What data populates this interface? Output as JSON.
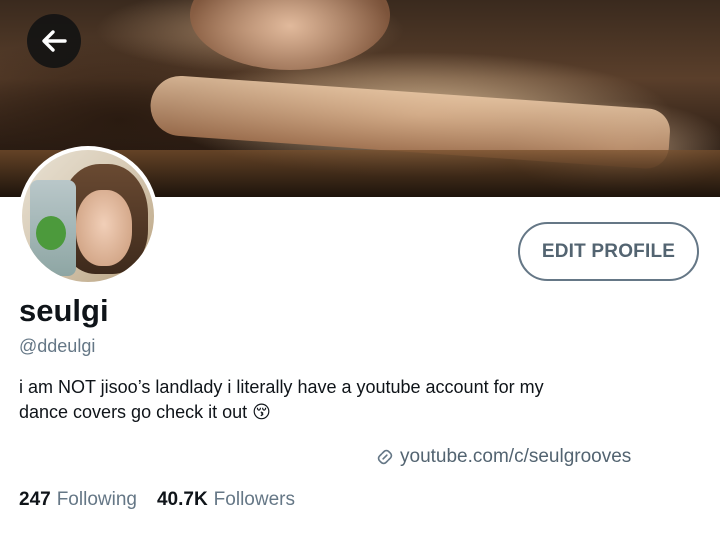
{
  "profile": {
    "display_name": "seulgi",
    "handle": "@ddeulgi",
    "bio_line1": "i am NOT jisoo’s landlady i literally have a youtube account for my",
    "bio_line2": "dance covers go check it out",
    "bio_emoji": "😚",
    "website": "youtube.com/c/seulgrooves"
  },
  "actions": {
    "edit_profile_label": "EDIT PROFILE"
  },
  "stats": {
    "following_count": "247",
    "following_label": "Following",
    "followers_count": "40.7K",
    "followers_label": "Followers"
  },
  "icons": {
    "back": "arrow-left-icon",
    "website": "link-icon"
  },
  "colors": {
    "secondary_text": "#657786",
    "primary_text": "#0f1419",
    "button_border": "#657786"
  }
}
